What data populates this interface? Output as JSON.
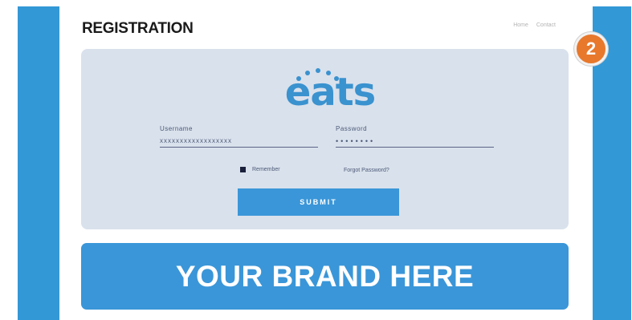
{
  "header": {
    "title": "REGISTRATION",
    "nav": [
      "Home",
      "Contact"
    ]
  },
  "step_badge": "2",
  "login": {
    "logo_text": "eats",
    "username": {
      "label": "Username",
      "value": "xxxxxxxxxxxxxxxxxx"
    },
    "password": {
      "label": "Password",
      "value": "••••••••"
    },
    "remember_label": "Remember",
    "forgot_label": "Forgot Password?",
    "submit_label": "SUBMIT"
  },
  "banner": {
    "text": "YOUR BRAND HERE"
  },
  "colors": {
    "accent": "#3398d6",
    "badge": "#e8782c",
    "card": "#d9e1ec",
    "title": "#1a1a1a"
  }
}
